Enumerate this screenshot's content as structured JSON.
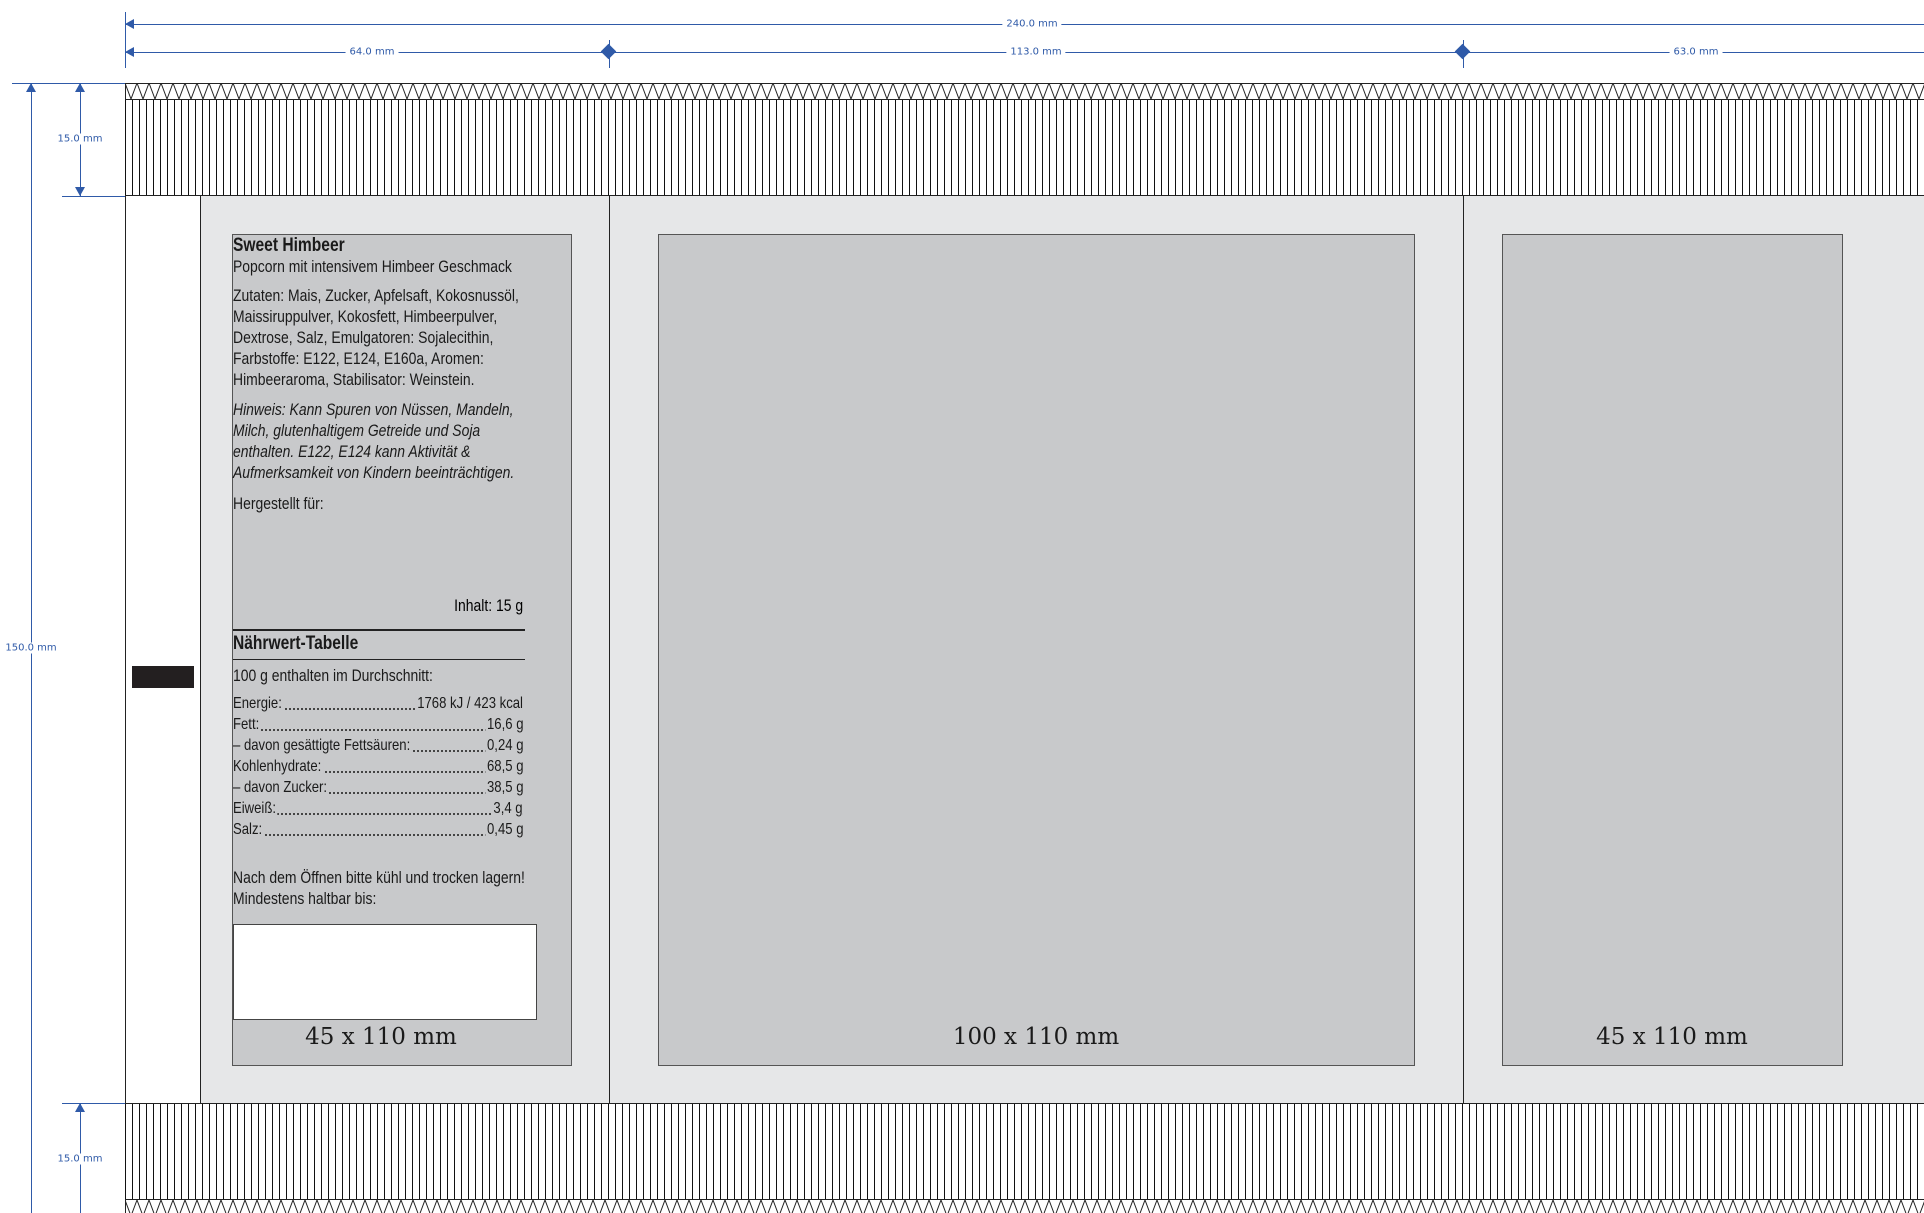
{
  "dimensions": {
    "total_width": "240.0 mm",
    "left_panel_width": "64.0 mm",
    "center_panel_width": "113.0 mm",
    "right_panel_width": "63.0 mm",
    "total_height": "150.0 mm",
    "top_seal_height": "15.0 mm",
    "bottom_seal_height": "15.0 mm"
  },
  "label": {
    "product_name": "Sweet Himbeer",
    "subtitle": "Popcorn mit intensivem Himbeer Geschmack",
    "ingredients_lines": [
      "Zutaten: Mais, Zucker, Apfelsaft, Kokosnussöl,",
      "Maissiruppulver, Kokosfett, Himbeerpulver,",
      "Dextrose, Salz, Emulgatoren: Sojalecithin,",
      "Farbstoffe: E122, E124, E160a, Aromen:",
      "Himbeeraroma, Stabilisator: Weinstein."
    ],
    "hint_lines": [
      "Hinweis: Kann Spuren von Nüssen, Mandeln,",
      "Milch, glutenhaltigem Getreide und Soja",
      "enthalten. E122, E124 kann Aktivität &",
      "Aufmerksamkeit von Kindern beeinträchtigen."
    ],
    "manufacturer": "Hergestellt für:",
    "contents": "Inhalt: 15 g",
    "nutrition_title": "Nährwert-Tabelle",
    "nutrition_intro": "100 g enthalten im Durchschnitt:",
    "nutrition": [
      {
        "name": "Energie:",
        "value": "1768 kJ / 423 kcal"
      },
      {
        "name": "Fett:",
        "value": "16,6 g"
      },
      {
        "name": "– davon gesättigte Fettsäuren:",
        "value": "0,24 g"
      },
      {
        "name": "Kohlenhydrate:",
        "value": "68,5 g"
      },
      {
        "name": "– davon Zucker:",
        "value": "38,5 g"
      },
      {
        "name": "Eiweiß:",
        "value": "3,4 g"
      },
      {
        "name": "Salz:",
        "value": "0,45 g"
      }
    ],
    "storage": "Nach dem Öffnen bitte kühl und trocken lagern!",
    "best_before": "Mindestens haltbar bis:"
  },
  "panels": {
    "left_size": "45 x 110 mm",
    "center_size": "100 x 110 mm",
    "right_size": "45 x 110 mm"
  },
  "colors": {
    "dimension_blue": "#2f5aa8",
    "panel_bg": "#e6e7e8",
    "label_gray": "#c8c9cb"
  }
}
